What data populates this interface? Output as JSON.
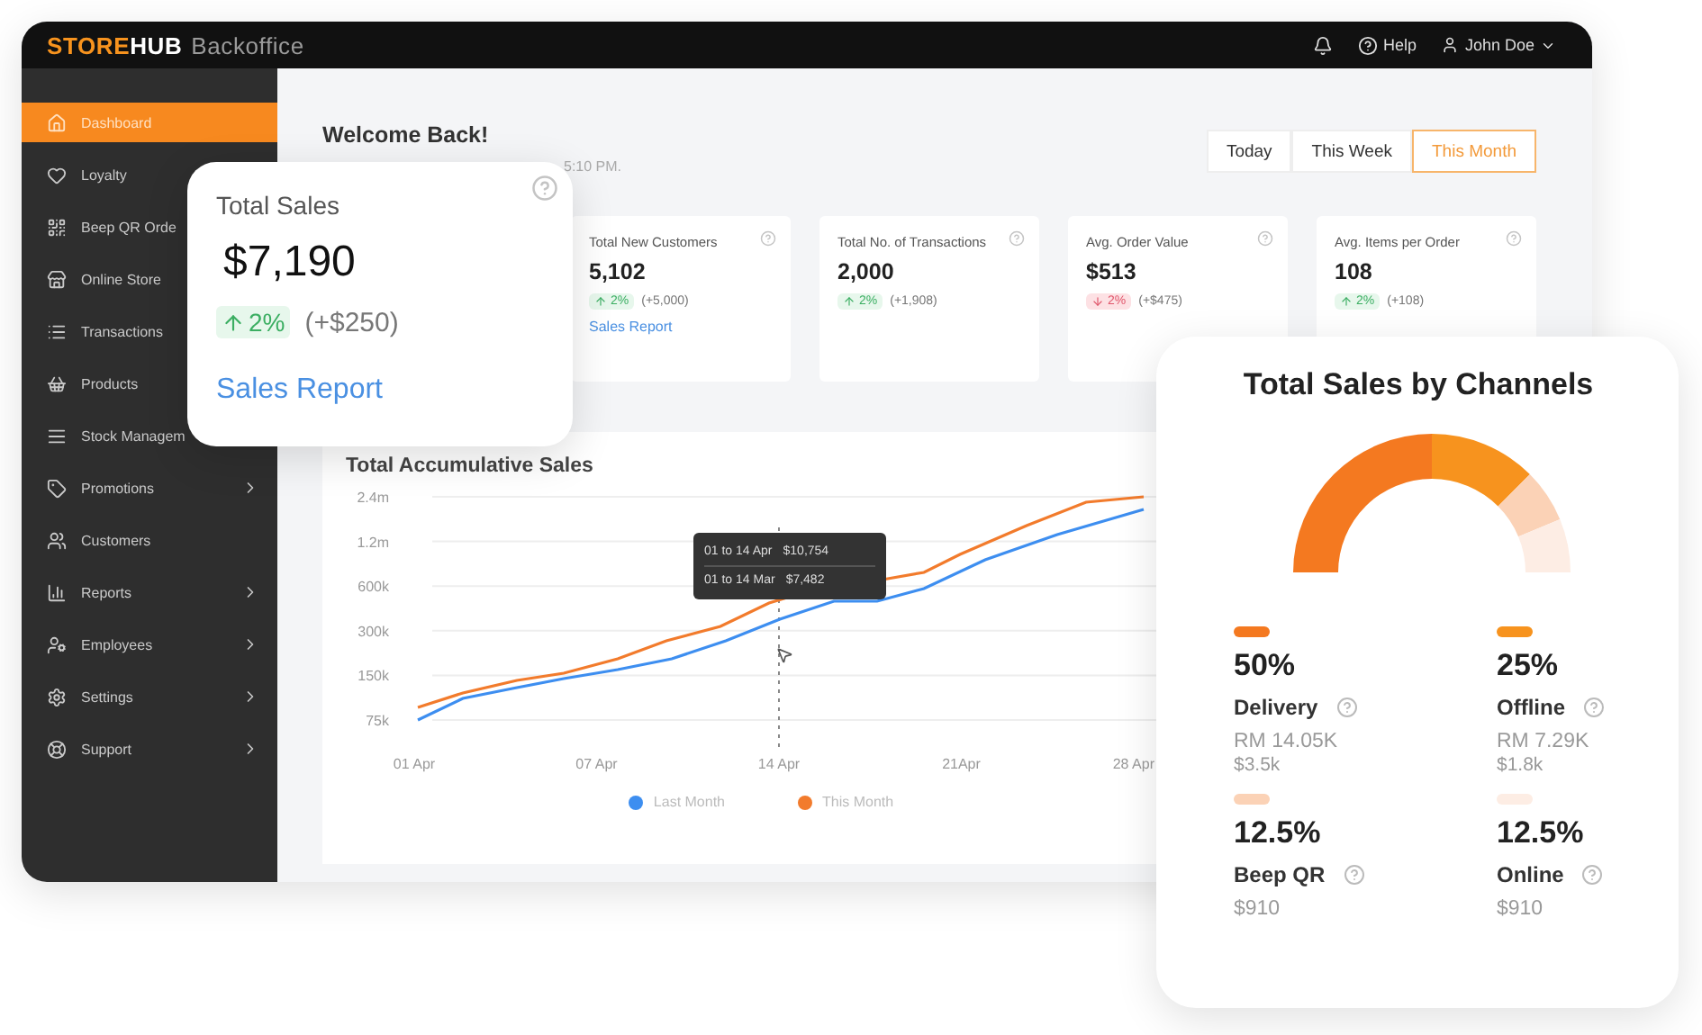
{
  "topbar": {
    "logo": {
      "primary": "STORE",
      "secondary": "HUB",
      "product": "Backoffice"
    },
    "help": "Help",
    "user": "John Doe"
  },
  "sidebar": {
    "items": [
      {
        "label": "Dashboard",
        "selected": true,
        "has_submenu": false
      },
      {
        "label": "Loyalty",
        "selected": false,
        "has_submenu": false
      },
      {
        "label": "Beep QR Orde",
        "selected": false,
        "has_submenu": false
      },
      {
        "label": "Online Store",
        "selected": false,
        "has_submenu": false
      },
      {
        "label": "Transactions",
        "selected": false,
        "has_submenu": false
      },
      {
        "label": "Products",
        "selected": false,
        "has_submenu": false
      },
      {
        "label": "Stock Managem",
        "selected": false,
        "has_submenu": false
      },
      {
        "label": "Promotions",
        "selected": false,
        "has_submenu": true
      },
      {
        "label": "Customers",
        "selected": false,
        "has_submenu": false
      },
      {
        "label": "Reports",
        "selected": false,
        "has_submenu": true
      },
      {
        "label": "Employees",
        "selected": false,
        "has_submenu": true
      },
      {
        "label": "Settings",
        "selected": false,
        "has_submenu": true
      },
      {
        "label": "Support",
        "selected": false,
        "has_submenu": true
      }
    ]
  },
  "header": {
    "title": "Welcome Back!",
    "subtitle": "5:10 PM.",
    "periods": [
      {
        "label": "Today",
        "selected": false
      },
      {
        "label": "This Week",
        "selected": false
      },
      {
        "label": "This Month",
        "selected": true
      }
    ]
  },
  "stats": [
    {
      "title": "Total New Customers",
      "value": "5,102",
      "negative": false,
      "change": "2%",
      "delta": "(+5,000)",
      "link": "Sales Report"
    },
    {
      "title": "Total No. of Transactions",
      "value": "2,000",
      "negative": false,
      "change": "2%",
      "delta": "(+1,908)"
    },
    {
      "title": "Avg. Order Value",
      "value": "$513",
      "negative": true,
      "change": "2%",
      "delta": "(+$475)"
    },
    {
      "title": "Avg. Items per Order",
      "value": "108",
      "negative": false,
      "change": "2%",
      "delta": "(+108)"
    }
  ],
  "sales_chart": {
    "title": "Total Accumulative Sales",
    "tooltip": [
      {
        "period": "01 to 14 Apr",
        "amount": "$10,754"
      },
      {
        "period": "01 to 14 Mar",
        "amount": "$7,482"
      }
    ],
    "y_labels": [
      "2.4m",
      "1.2m",
      "600k",
      "300k",
      "150k",
      "75k"
    ],
    "x_labels": [
      "01 Apr",
      "07 Apr",
      "14 Apr",
      "21Apr",
      "28 Apr"
    ],
    "legend": [
      {
        "name": "Last Month",
        "color": "#3d8ef0"
      },
      {
        "name": "This Month",
        "color": "#f27b2c"
      }
    ]
  },
  "total_sales_card": {
    "title": "Total Sales",
    "value": "$7,190",
    "negative": false,
    "change": "2%",
    "delta": "(+$250)",
    "link": "Sales Report"
  },
  "channels_card": {
    "title": "Total Sales by Channels",
    "chart_data": {
      "type": "donut",
      "values": [
        50,
        25,
        12.5,
        12.5
      ]
    },
    "channels": [
      {
        "percent": "50%",
        "name": "Delivery",
        "color": "#f47920",
        "amounts": [
          "RM 14.05K",
          "$3.5k"
        ]
      },
      {
        "percent": "25%",
        "name": "Offline",
        "color": "#f7931e",
        "amounts": [
          "RM 7.29K",
          "$1.8k"
        ]
      },
      {
        "percent": "12.5%",
        "name": "Beep QR",
        "color": "#fbd2b6",
        "amounts": [
          "$910"
        ]
      },
      {
        "percent": "12.5%",
        "name": "Online",
        "color": "#fdede4",
        "amounts": [
          "$910"
        ]
      }
    ]
  }
}
